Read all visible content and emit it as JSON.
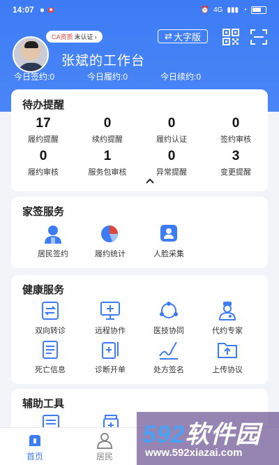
{
  "status_bar": {
    "time": "14:07",
    "network": "4G",
    "battery": ""
  },
  "header": {
    "ca_label": "CA资质",
    "ca_status": "未认证",
    "big_font_label": "大字版",
    "workspace_title": "张斌的工作台",
    "stats": [
      "今日签约:0",
      "今日履约:0",
      "今日续约:0"
    ]
  },
  "todo": {
    "title": "待办提醒",
    "items": [
      {
        "count": "17",
        "label": "履约提醒"
      },
      {
        "count": "0",
        "label": "续约提醒"
      },
      {
        "count": "0",
        "label": "履约认证"
      },
      {
        "count": "0",
        "label": "签约审核"
      },
      {
        "count": "0",
        "label": "履约审核"
      },
      {
        "count": "1",
        "label": "服务包审核"
      },
      {
        "count": "0",
        "label": "异常提醒"
      },
      {
        "count": "3",
        "label": "变更提醒"
      }
    ]
  },
  "family_service": {
    "title": "家签服务",
    "items": [
      {
        "label": "居民签约",
        "icon": "resident-icon"
      },
      {
        "label": "履约统计",
        "icon": "pie-chart-icon"
      },
      {
        "label": "人脸采集",
        "icon": "face-capture-icon"
      }
    ]
  },
  "health_service": {
    "title": "健康服务",
    "items": [
      {
        "label": "双向转诊",
        "icon": "referral-icon"
      },
      {
        "label": "远程协作",
        "icon": "remote-monitor-icon"
      },
      {
        "label": "医技协同",
        "icon": "network-icon"
      },
      {
        "label": "代约专家",
        "icon": "doctor-icon"
      },
      {
        "label": "死亡信息",
        "icon": "document-list-icon"
      },
      {
        "label": "诊断开单",
        "icon": "prescription-icon"
      },
      {
        "label": "处方签名",
        "icon": "signature-icon"
      },
      {
        "label": "上传协议",
        "icon": "upload-folder-icon"
      }
    ]
  },
  "tools": {
    "title": "辅助工具"
  },
  "tabbar": {
    "tabs": [
      {
        "label": "首页",
        "active": true
      },
      {
        "label": "居民",
        "active": false
      }
    ]
  },
  "watermark": {
    "brand_num": "592",
    "brand_text": "软件园",
    "url": "www.592xiazai.com"
  },
  "colors": {
    "primary": "#3d7cf5",
    "accent": "#e0463c"
  }
}
